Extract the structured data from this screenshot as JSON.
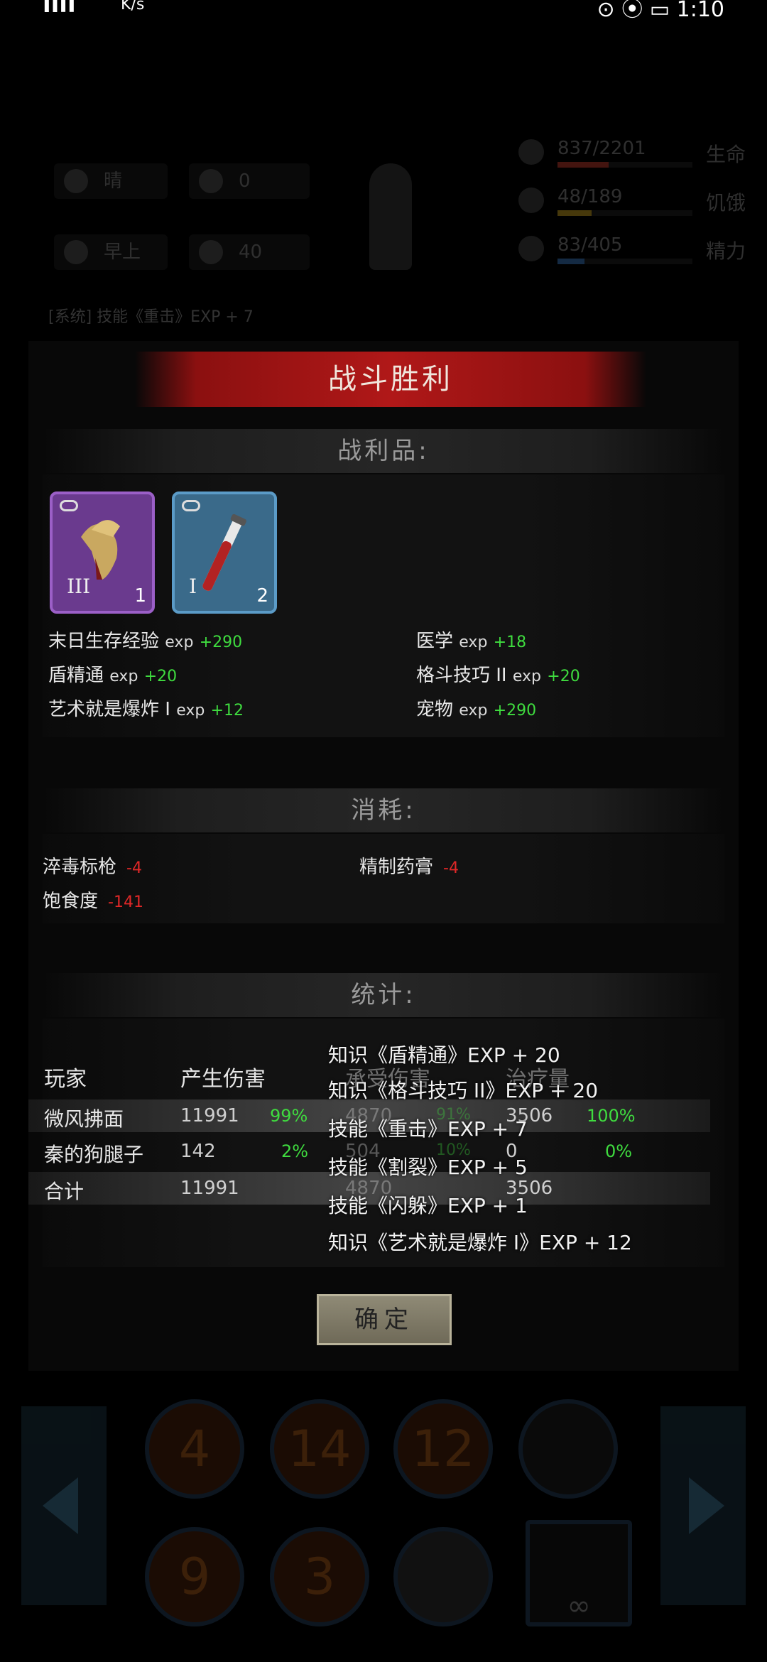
{
  "status_bar": {
    "signal": "ııll",
    "speed": "K/s",
    "right": "⊙ ⦿ ▭ 1:10"
  },
  "hud": {
    "weather": "晴",
    "radiation": "0",
    "time_of_day": "早上",
    "temperature": "40",
    "stats": [
      {
        "value": "837/2201",
        "label": "生命",
        "color": "#c0392b",
        "ratio": 0.38
      },
      {
        "value": "48/189",
        "label": "饥饿",
        "color": "#c8a020",
        "ratio": 0.25
      },
      {
        "value": "83/405",
        "label": "精力",
        "color": "#3a7ac0",
        "ratio": 0.2
      }
    ],
    "log_line": "[系统] 技能《重击》EXP + 7"
  },
  "dialog": {
    "title": "战斗胜利",
    "loot_header": "战利品:",
    "items": [
      {
        "icon": "claw-item-icon",
        "tier": "III",
        "count": "1",
        "rarity": "purple"
      },
      {
        "icon": "syringe-item-icon",
        "tier": "I",
        "count": "2",
        "rarity": "blue"
      }
    ],
    "exp_gains": [
      {
        "name": "末日生存经验",
        "unit": "exp",
        "amount": "+290"
      },
      {
        "name": "医学",
        "unit": "exp",
        "amount": "+18"
      },
      {
        "name": "盾精通",
        "unit": "exp",
        "amount": "+20"
      },
      {
        "name": "格斗技巧 II",
        "unit": "exp",
        "amount": "+20"
      },
      {
        "name": "艺术就是爆炸 I",
        "unit": "exp",
        "amount": "+12"
      },
      {
        "name": "宠物",
        "unit": "exp",
        "amount": "+290"
      }
    ],
    "consume_header": "消耗:",
    "consumed": [
      {
        "name": "淬毒标枪",
        "amount": "-4"
      },
      {
        "name": "精制药膏",
        "amount": "-4"
      },
      {
        "name": "饱食度",
        "amount": "-141"
      }
    ],
    "stats_header": "统计:",
    "stats_columns": [
      "玩家",
      "产生伤害",
      "承受伤害",
      "治疗量"
    ],
    "stats_rows": [
      {
        "player": "微风拂面",
        "dmg": "11991",
        "dmg_pct": "99%",
        "taken": "4870",
        "taken_pct": "91%",
        "heal": "3506",
        "heal_pct": "100%"
      },
      {
        "player": "秦的狗腿子",
        "dmg": "142",
        "dmg_pct": "2%",
        "taken": "504",
        "taken_pct": "10%",
        "heal": "0",
        "heal_pct": "0%"
      },
      {
        "player": "合计",
        "dmg": "11991",
        "dmg_pct": "",
        "taken": "4870",
        "taken_pct": "",
        "heal": "3506",
        "heal_pct": ""
      }
    ],
    "skill_toasts": [
      "知识《盾精通》EXP + 20",
      "知识《格斗技巧 II》EXP + 20",
      "技能《重击》EXP + 7",
      "技能《割裂》EXP + 5",
      "技能《闪躲》EXP + 1",
      "知识《艺术就是爆炸 I》EXP + 12"
    ],
    "confirm_label": "确定"
  },
  "action_bar": {
    "skills_top": [
      "4",
      "14",
      "12",
      ""
    ],
    "skills_bottom": [
      "9",
      "3",
      "",
      "∞"
    ]
  }
}
